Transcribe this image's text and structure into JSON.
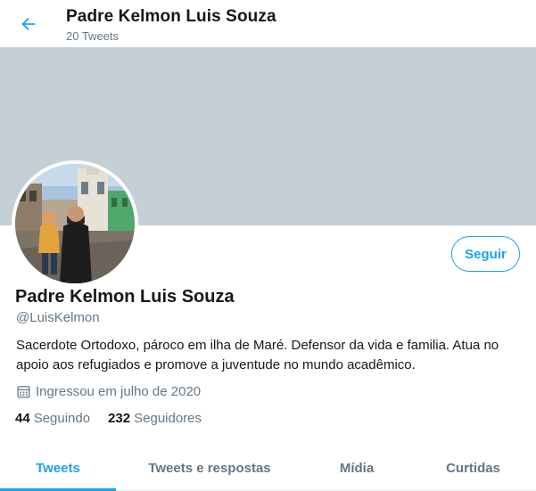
{
  "header": {
    "title": "Padre Kelmon Luis Souza",
    "tweet_count": "20 Tweets"
  },
  "profile": {
    "name": "Padre Kelmon Luis Souza",
    "handle": "@LuisKelmon",
    "bio": "Sacerdote Ortodoxo, pároco em ilha de Maré. Defensor da vida e familia. Atua no apoio aos refugiados e promove a juventude no mundo acadêmico.",
    "joined": "Ingressou em julho de 2020",
    "following_count": "44",
    "following_label": "Seguindo",
    "followers_count": "232",
    "followers_label": "Seguidores",
    "follow_button": "Seguir"
  },
  "tabs": [
    {
      "label": "Tweets",
      "active": true
    },
    {
      "label": "Tweets e respostas",
      "active": false
    },
    {
      "label": "Mídia",
      "active": false
    },
    {
      "label": "Curtidas",
      "active": false
    }
  ],
  "icons": {
    "back": "arrow-left-icon",
    "joined": "calendar-icon"
  },
  "colors": {
    "accent": "#1da1f2",
    "banner": "#c4cfd6",
    "secondary_text": "#657786",
    "primary_text": "#14171a"
  }
}
